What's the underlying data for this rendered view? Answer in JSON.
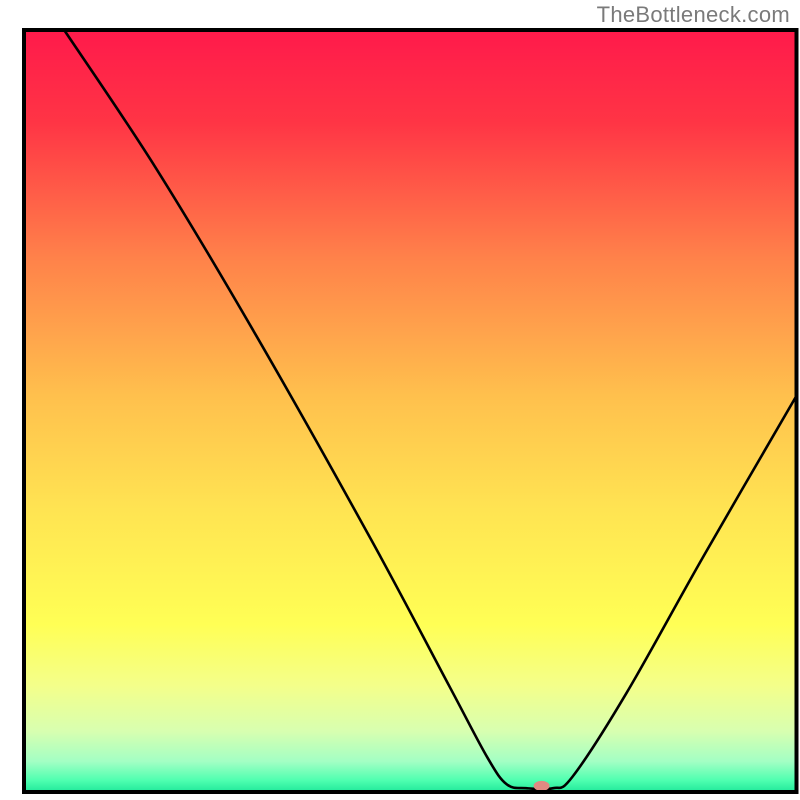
{
  "watermark": "TheBottleneck.com",
  "chart_data": {
    "type": "line",
    "title": "",
    "xlabel": "",
    "ylabel": "",
    "xlim": [
      0,
      100
    ],
    "ylim": [
      0,
      100
    ],
    "grid": false,
    "legend": false,
    "background_gradient": {
      "stops": [
        {
          "offset": 0.0,
          "color": "#ff1a4b"
        },
        {
          "offset": 0.12,
          "color": "#ff3445"
        },
        {
          "offset": 0.3,
          "color": "#ff824a"
        },
        {
          "offset": 0.48,
          "color": "#ffc04d"
        },
        {
          "offset": 0.63,
          "color": "#ffe452"
        },
        {
          "offset": 0.78,
          "color": "#ffff55"
        },
        {
          "offset": 0.86,
          "color": "#f4ff8a"
        },
        {
          "offset": 0.92,
          "color": "#d8ffb0"
        },
        {
          "offset": 0.96,
          "color": "#a3ffc4"
        },
        {
          "offset": 0.985,
          "color": "#4effb0"
        },
        {
          "offset": 1.0,
          "color": "#20e89a"
        }
      ]
    },
    "series": [
      {
        "name": "bottleneck-curve",
        "stroke": "#000000",
        "stroke_width": 2.6,
        "points": [
          {
            "x": 5.2,
            "y": 100.0
          },
          {
            "x": 17.0,
            "y": 82.0
          },
          {
            "x": 30.0,
            "y": 60.0
          },
          {
            "x": 45.0,
            "y": 33.0
          },
          {
            "x": 55.0,
            "y": 14.0
          },
          {
            "x": 60.0,
            "y": 4.5
          },
          {
            "x": 62.5,
            "y": 1.0
          },
          {
            "x": 65.0,
            "y": 0.5
          },
          {
            "x": 68.5,
            "y": 0.5
          },
          {
            "x": 71.0,
            "y": 2.0
          },
          {
            "x": 78.0,
            "y": 13.0
          },
          {
            "x": 88.0,
            "y": 31.0
          },
          {
            "x": 100.0,
            "y": 52.0
          }
        ]
      }
    ],
    "marker": {
      "name": "optimal-point",
      "x": 67.0,
      "y": 0.8,
      "rx": 8,
      "ry": 5,
      "fill": "#e08a82"
    },
    "frame": {
      "stroke": "#000000",
      "stroke_width": 4
    }
  }
}
